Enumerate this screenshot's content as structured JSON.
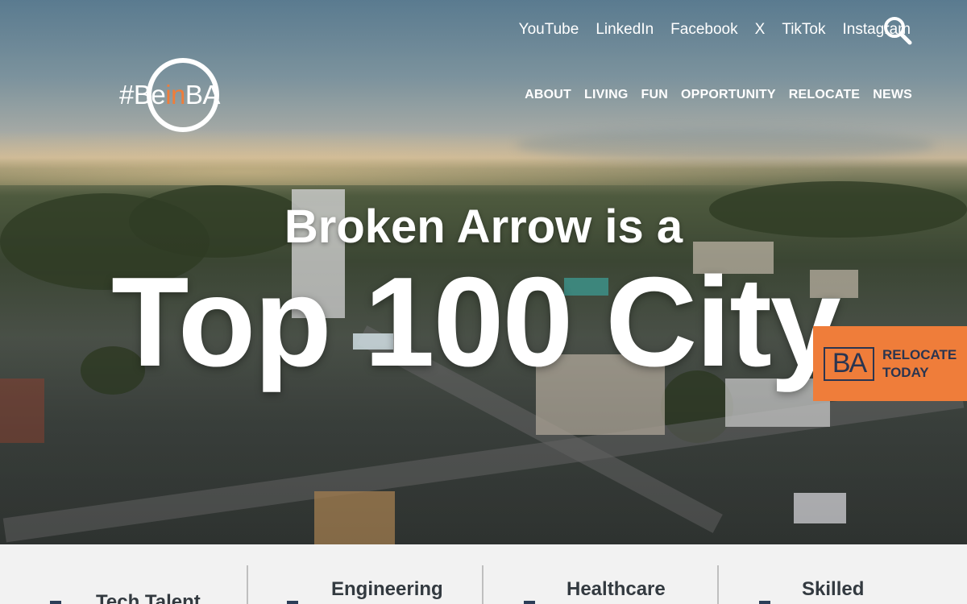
{
  "social_links": [
    "YouTube",
    "LinkedIn",
    "Facebook",
    "X",
    "TikTok",
    "Instagram"
  ],
  "logo": {
    "prefix": "#Be",
    "highlight": "in",
    "suffix": "BA"
  },
  "nav": [
    "ABOUT",
    "LIVING",
    "FUN",
    "OPPORTUNITY",
    "RELOCATE",
    "NEWS"
  ],
  "hero": {
    "line1": "Broken Arrow is a",
    "line2": "Top 100 City"
  },
  "cta": {
    "badge": "BA",
    "line1": "RELOCATE",
    "line2": "TODAY"
  },
  "industries": [
    "Tech Talent",
    "Engineering",
    "Healthcare",
    "Skilled"
  ],
  "colors": {
    "accent": "#ef7d3a",
    "navy": "#2a3550",
    "text_dark": "#333a40"
  }
}
